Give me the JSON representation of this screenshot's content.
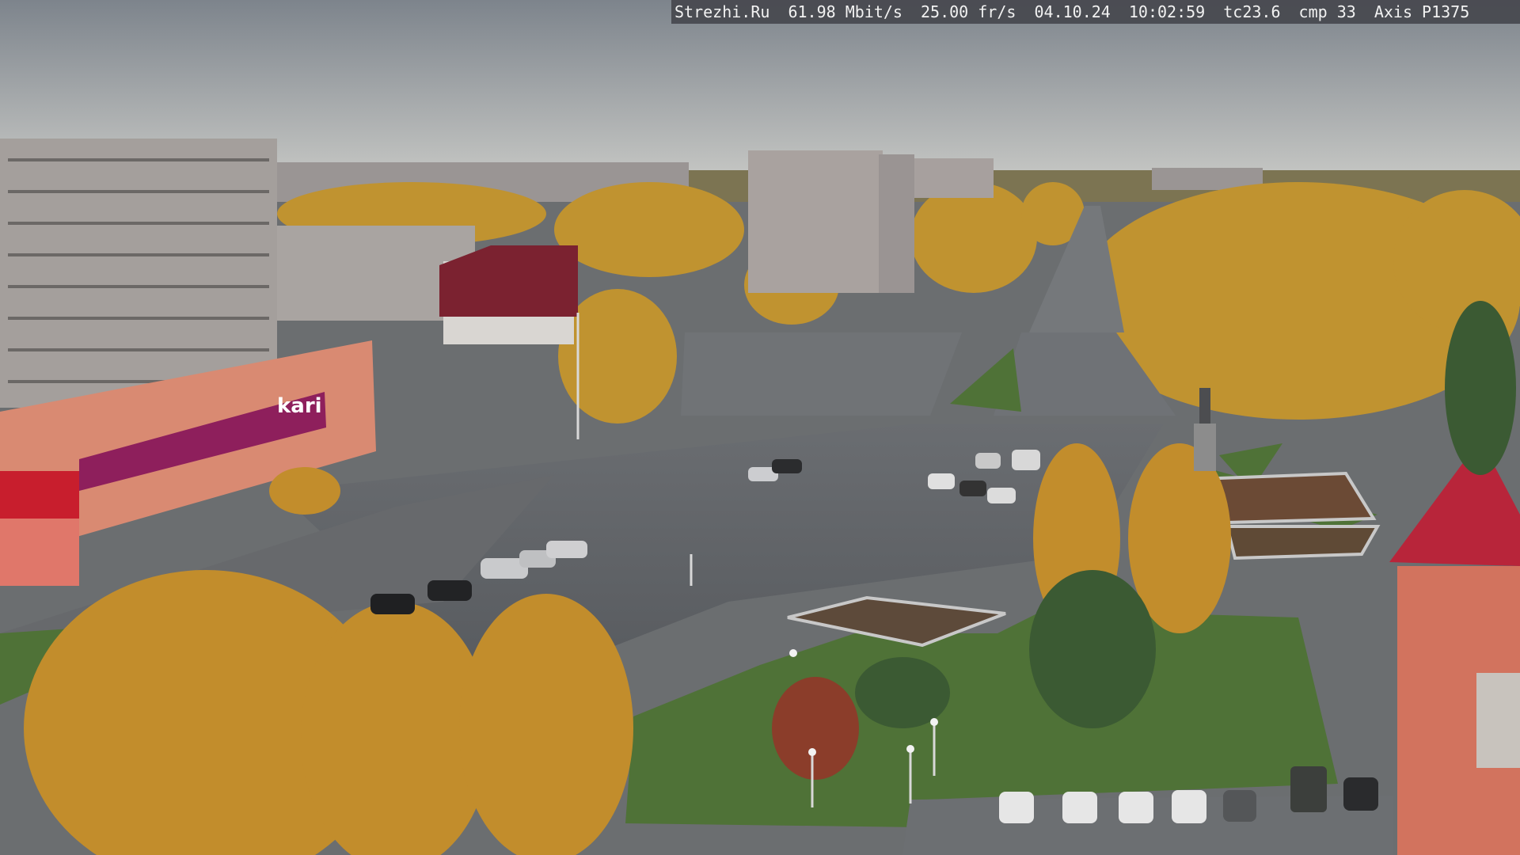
{
  "overlay": {
    "site": "Strezhi.Ru",
    "bitrate": "61.98 Mbit/s",
    "framerate": "25.00 fr/s",
    "date": "04.10.24",
    "time": "10:02:59",
    "tc": "tc23.6",
    "cmp": "cmp 33",
    "camera": "Axis P1375"
  },
  "signs": {
    "store_brand": "kari"
  },
  "colors": {
    "sky_top": "#8a9096",
    "sky_bottom": "#c4c6c6",
    "asphalt": "#5e6166",
    "foliage": "#c9962e",
    "grass": "#4f7237",
    "brand_magenta": "#8e1f5c",
    "roof_red": "#b8253a"
  }
}
